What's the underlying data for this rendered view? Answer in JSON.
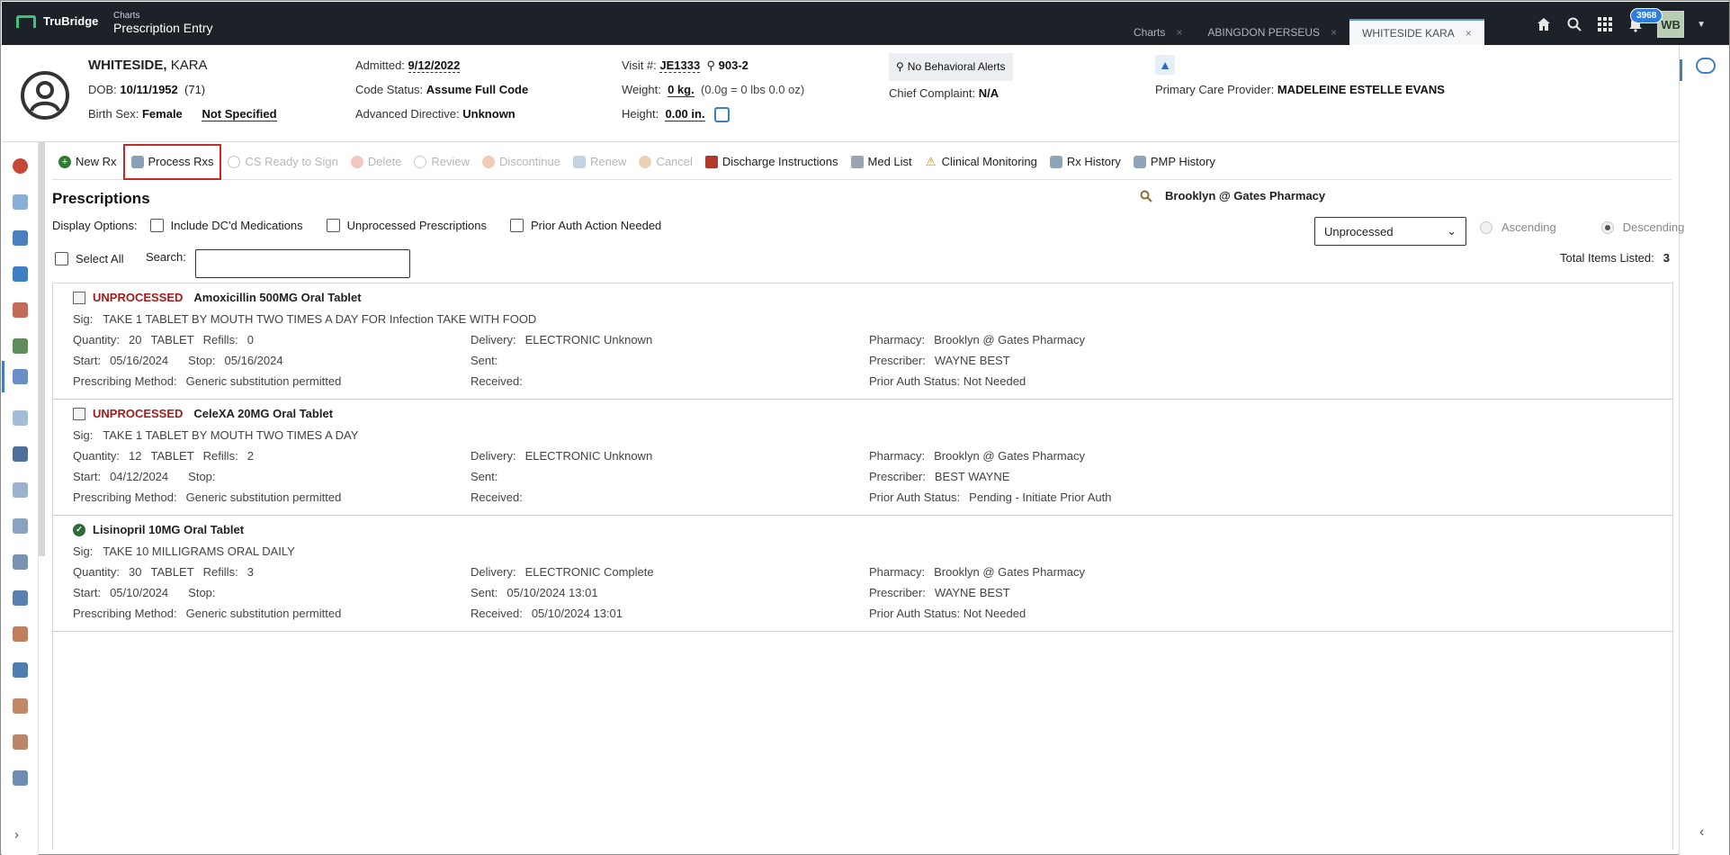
{
  "topbar": {
    "logo_text": "TruBridge",
    "app_sub": "Charts",
    "app_title": "Prescription Entry",
    "tabs": [
      {
        "label": "Charts",
        "close": "×"
      },
      {
        "label": "ABINGDON PERSEUS",
        "close": "×"
      },
      {
        "label": "WHITESIDE KARA",
        "close": "×"
      }
    ],
    "notification_count": "3968",
    "user_initials": "WB"
  },
  "patient": {
    "last_name": "WHITESIDE,",
    "first_name": "KARA",
    "dob_label": "DOB:",
    "dob": "10/11/1952",
    "age": "(71)",
    "sex_label": "Birth Sex:",
    "sex": "Female",
    "gender": "Not Specified",
    "admitted_label": "Admitted:",
    "admitted": "9/12/2022",
    "code_status_label": "Code Status:",
    "code_status": "Assume Full Code",
    "adv_directive_label": "Advanced Directive:",
    "adv_directive": "Unknown",
    "visit_label": "Visit #:",
    "visit": "JE1333",
    "room": "903-2",
    "weight_label": "Weight:",
    "weight": "0 kg.",
    "weight_detail": "(0.0g = 0 lbs 0.0 oz)",
    "height_label": "Height:",
    "height": "0.00 in.",
    "behavioral": "No Behavioral Alerts",
    "complaint_label": "Chief Complaint:",
    "complaint": "N/A",
    "pcp_label": "Primary Care Provider:",
    "pcp": "MADELEINE ESTELLE EVANS"
  },
  "toolbar": {
    "new_rx": "New Rx",
    "process_rxs": "Process Rxs",
    "cs_ready": "CS Ready to Sign",
    "delete": "Delete",
    "review": "Review",
    "discontinue": "Discontinue",
    "renew": "Renew",
    "cancel": "Cancel",
    "discharge": "Discharge Instructions",
    "med_list": "Med List",
    "clinical_monitoring": "Clinical Monitoring",
    "rx_history": "Rx History",
    "pmp_history": "PMP History"
  },
  "content": {
    "title": "Prescriptions",
    "pharmacy": "Brooklyn @ Gates Pharmacy",
    "display_options_label": "Display Options:",
    "opt_dc": "Include DC'd Medications",
    "opt_unprocessed": "Unprocessed Prescriptions",
    "opt_prior_auth": "Prior Auth Action Needed",
    "sort_value": "Unprocessed",
    "ascending": "Ascending",
    "descending": "Descending",
    "select_all": "Select All",
    "search_label": "Search:",
    "search_value": "",
    "total_label": "Total Items Listed:",
    "total_value": "3"
  },
  "rx_labels": {
    "sig": "Sig:",
    "quantity": "Quantity:",
    "refills": "Refills:",
    "start": "Start:",
    "stop": "Stop:",
    "method": "Prescribing Method:",
    "delivery": "Delivery:",
    "sent": "Sent:",
    "received": "Received:",
    "pharmacy": "Pharmacy:",
    "prescriber": "Prescriber:",
    "prior_auth": "Prior Auth Status:"
  },
  "prescriptions": [
    {
      "status": "UNPROCESSED",
      "drug": "Amoxicillin 500MG Oral Tablet",
      "sig": "TAKE 1 TABLET BY MOUTH TWO TIMES A DAY FOR Infection TAKE WITH FOOD",
      "quantity": "20",
      "unit": "TABLET",
      "refills": "0",
      "start": "05/16/2024",
      "stop": "05/16/2024",
      "method": "Generic substitution permitted",
      "delivery": "ELECTRONIC Unknown",
      "sent": "",
      "received": "",
      "pharmacy": "Brooklyn @ Gates Pharmacy",
      "prescriber": "WAYNE BEST",
      "prior_auth": "Not Needed"
    },
    {
      "status": "UNPROCESSED",
      "drug": "CeleXA 20MG Oral Tablet",
      "sig": "TAKE 1 TABLET BY MOUTH TWO TIMES A DAY",
      "quantity": "12",
      "unit": "TABLET",
      "refills": "2",
      "start": "04/12/2024",
      "stop": "",
      "method": "Generic substitution permitted",
      "delivery": "ELECTRONIC Unknown",
      "sent": "",
      "received": "",
      "pharmacy": "Brooklyn @ Gates Pharmacy",
      "prescriber": "BEST WAYNE",
      "prior_auth": "Pending - Initiate Prior Auth"
    },
    {
      "status": "",
      "drug": "Lisinopril 10MG Oral Tablet",
      "sig": "TAKE 10 MILLIGRAMS ORAL DAILY",
      "quantity": "30",
      "unit": "TABLET",
      "refills": "3",
      "start": "05/10/2024",
      "stop": "",
      "method": "Generic substitution permitted",
      "delivery": "ELECTRONIC Complete",
      "sent": "05/10/2024 13:01",
      "received": "05/10/2024 13:01",
      "pharmacy": "Brooklyn @ Gates Pharmacy",
      "prescriber": "WAYNE BEST",
      "prior_auth": "Not Needed"
    }
  ],
  "colors": {
    "topbar": "#1d2228",
    "accent": "#3e7fc3",
    "unprocessed": "#a31c1c",
    "highlight_border": "#c62828"
  }
}
